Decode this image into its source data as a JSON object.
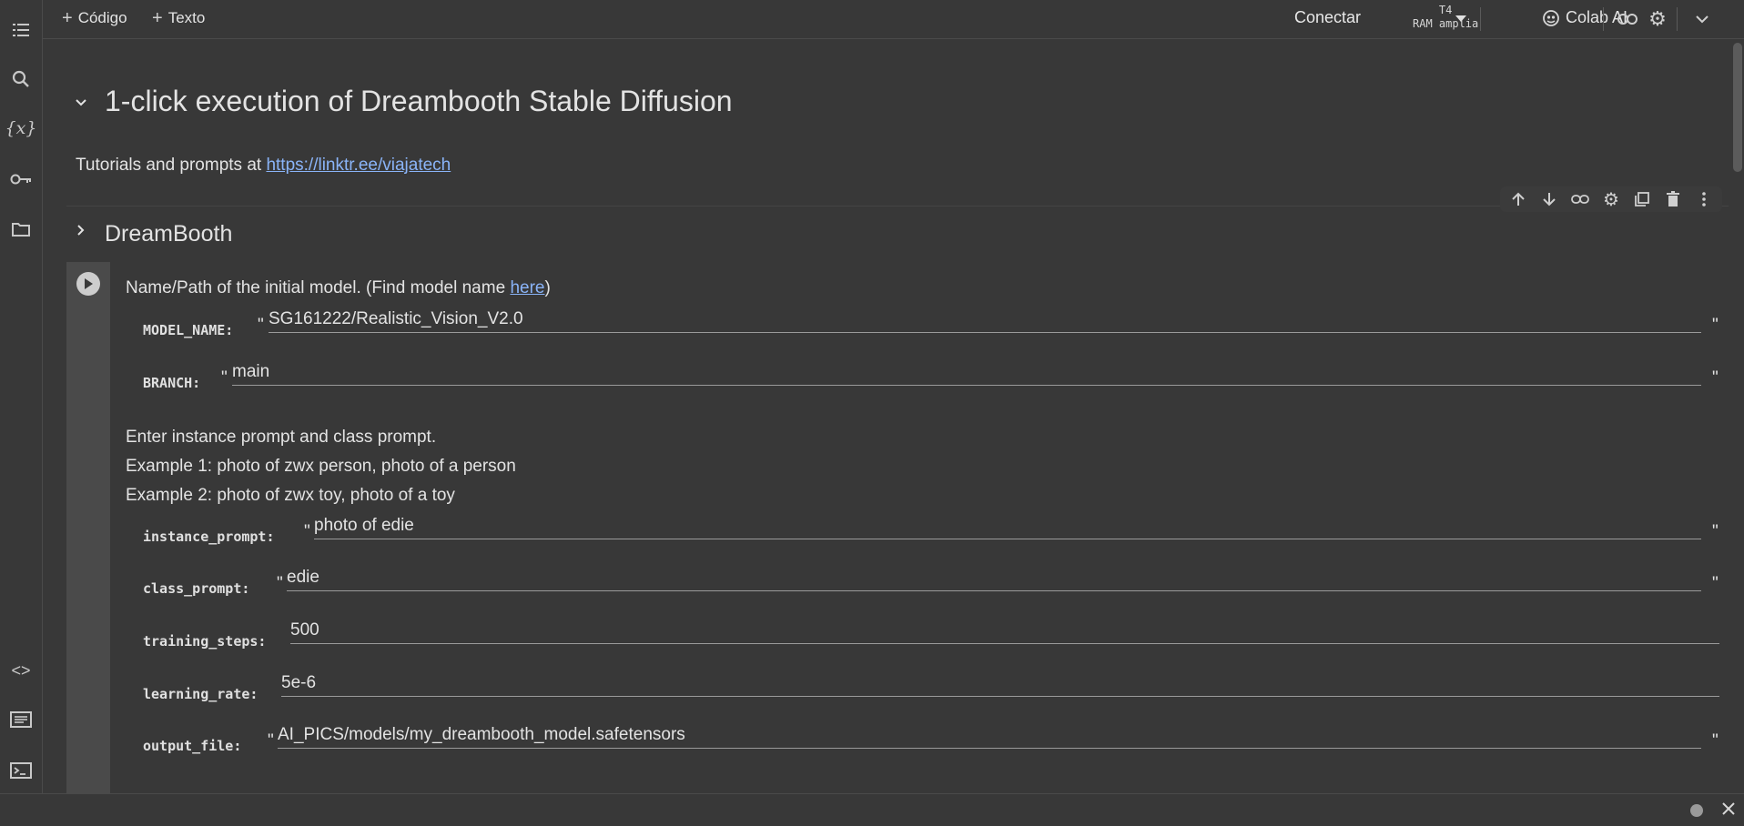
{
  "toolbar": {
    "add_code": "Código",
    "add_text": "Texto",
    "connect": "Conectar",
    "runtime_gpu": "T4",
    "runtime_ram": "RAM amplia",
    "colab_ai": "Colab AI"
  },
  "notebook": {
    "title": "1-click execution of Dreambooth Stable Diffusion",
    "intro_prefix": "Tutorials and prompts at ",
    "intro_link": "https://linktr.ee/viajatech",
    "section": "DreamBooth"
  },
  "form": {
    "model_desc_prefix": "Name/Path of the initial model. (Find model name ",
    "model_desc_link": "here",
    "model_desc_suffix": ")",
    "model_name": {
      "label": "MODEL_NAME:",
      "value": "SG161222/Realistic_Vision_V2.0"
    },
    "branch": {
      "label": "BRANCH:",
      "value": "main"
    },
    "prompt_desc_1": "Enter instance prompt and class prompt.",
    "prompt_desc_2": "Example 1: photo of zwx person, photo of a person",
    "prompt_desc_3": "Example 2: photo of zwx toy, photo of a toy",
    "instance_prompt": {
      "label": "instance_prompt:",
      "value": "photo of edie"
    },
    "class_prompt": {
      "label": "class_prompt:",
      "value": "edie"
    },
    "training_steps": {
      "label": "training_steps:",
      "value": "500"
    },
    "learning_rate": {
      "label": "learning_rate:",
      "value": "5e-6"
    },
    "output_file": {
      "label": "output_file:",
      "value": "AI_PICS/models/my_dreambooth_model.safetensors"
    }
  },
  "quote": "\"",
  "icons": {
    "sidebar": [
      "toc-icon",
      "search-icon",
      "variables-icon",
      "key-icon",
      "folder-icon",
      "code-snippets-icon",
      "command-palette-icon",
      "terminal-icon"
    ],
    "cell_toolbar": [
      "arrow-up-icon",
      "arrow-down-icon",
      "link-icon",
      "gear-icon",
      "mirror-cell-icon",
      "delete-icon",
      "more-vert-icon"
    ]
  },
  "colors": {
    "background": "#383838",
    "link": "#8ab4f8",
    "gutter": "#4a4a4a"
  }
}
